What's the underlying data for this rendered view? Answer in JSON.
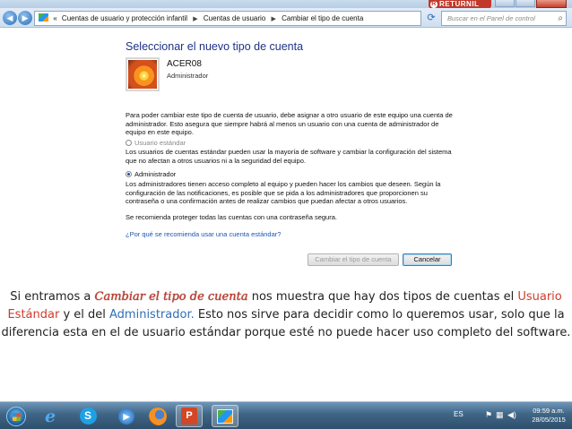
{
  "window": {
    "returnil_label": "RETURNIL",
    "address": {
      "crumb1": "Cuentas de usuario y protección infantil",
      "crumb2": "Cuentas de usuario",
      "crumb3": "Cambiar el tipo de cuenta",
      "back_arrow": "«"
    },
    "search_placeholder": "Buscar en el Panel de control",
    "page_title": "Seleccionar el nuevo tipo de cuenta",
    "account": {
      "name": "ACER08",
      "role": "Administrador"
    },
    "intro_text": "Para poder cambiar este tipo de cuenta de usuario, debe asignar a otro usuario de este equipo una cuenta de administrador. Esto asegura que siempre habrá al menos un usuario con una cuenta de administrador de equipo en este equipo.",
    "options": [
      {
        "label": "Usuario estándar",
        "selected": false,
        "description": "Los usuarios de cuentas estándar pueden usar la mayoría de software y cambiar la configuración del sistema que no afectan a otros usuarios ni a la seguridad del equipo."
      },
      {
        "label": "Administrador",
        "selected": true,
        "description": "Los administradores tienen acceso completo al equipo y pueden hacer los cambios que deseen. Según la configuración de las notificaciones, es posible que se pida a los administradores que proporcionen su contraseña o una confirmación antes de realizar cambios que puedan afectar a otros usuarios."
      }
    ],
    "recommend_text": "Se recomienda proteger todas las cuentas con una contraseña segura.",
    "help_link": "¿Por qué se recomienda usar una cuenta estándar?",
    "buttons": {
      "change": "Cambiar el tipo de cuenta",
      "cancel": "Cancelar"
    }
  },
  "caption": {
    "part1": "Si entramos a ",
    "highlight": "Cambiar el tipo de cuenta",
    "part2": " nos muestra que hay dos tipos de cuentas el ",
    "usuario_estandar": "Usuario Estándar",
    "part3": " y el del ",
    "administrador": "Administrador.",
    "part4": " Esto nos sirve para decidir como lo queremos usar, solo que la diferencia esta en el de usuario estándar porque esté no puede hacer uso completo del software."
  },
  "taskbar": {
    "language": "ES",
    "time": "09:59 a.m.",
    "date": "28/05/2015",
    "ppt_label": "P",
    "skype_label": "S"
  },
  "colors": {
    "title_blue": "#1e3287",
    "link_blue": "#1c55b5",
    "caption_red": "#d13b2c",
    "caption_blue": "#2f6fb8"
  }
}
